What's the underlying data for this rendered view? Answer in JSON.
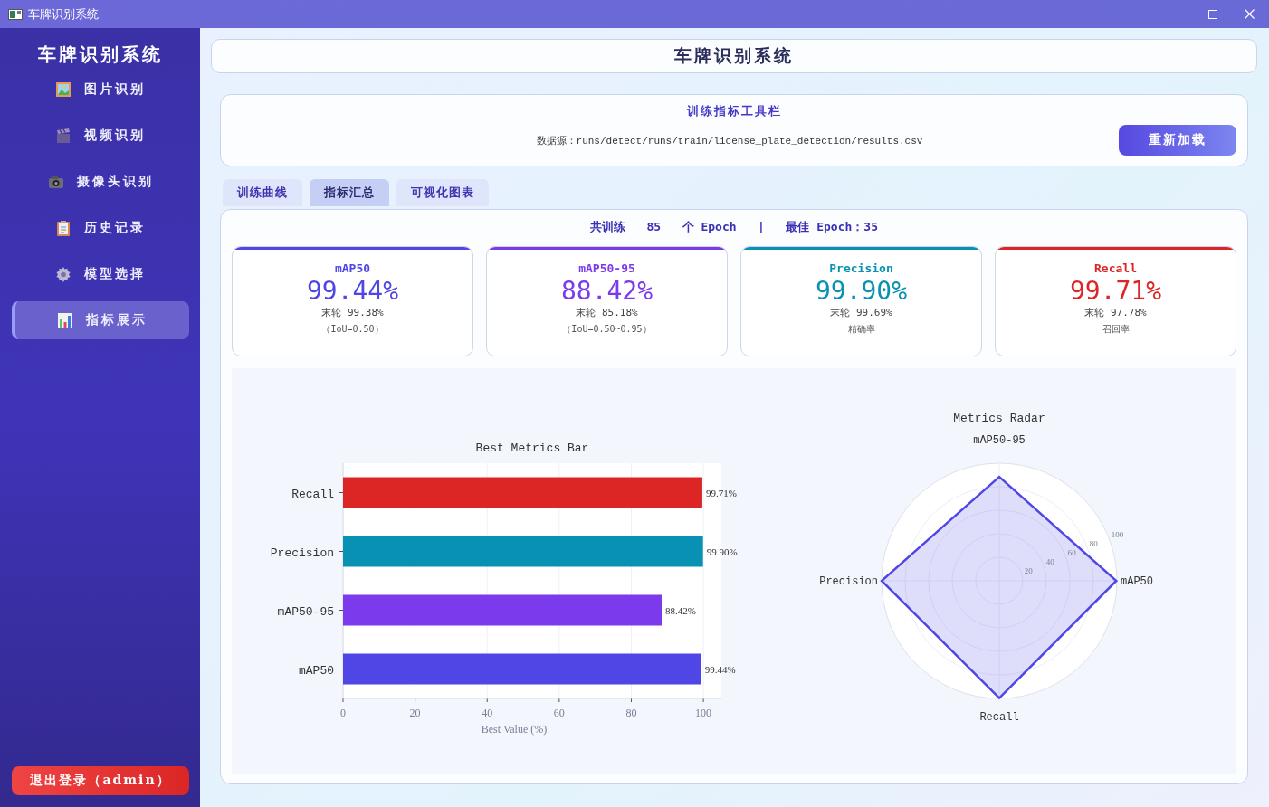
{
  "window": {
    "title": "车牌识别系统"
  },
  "sidebar": {
    "title": "车牌识别系统",
    "items": [
      {
        "label": "图片识别",
        "selected": false
      },
      {
        "label": "视频识别",
        "selected": false
      },
      {
        "label": "摄像头识别",
        "selected": false
      },
      {
        "label": "历史记录",
        "selected": false
      },
      {
        "label": "模型选择",
        "selected": false
      },
      {
        "label": "指标展示",
        "selected": true
      }
    ],
    "logout_button": "退出登录（admin）"
  },
  "header": {
    "title": "车牌识别系统"
  },
  "toolbar": {
    "title": "训练指标工具栏",
    "source": "数据源：runs/detect/runs/train/license_plate_detection/results.csv",
    "reload_button": "重新加载"
  },
  "tabs": [
    {
      "label": "训练曲线",
      "selected": false
    },
    {
      "label": "指标汇总",
      "selected": true
    },
    {
      "label": "可视化图表",
      "selected": false
    }
  ],
  "summary": "共训练   85   个 Epoch   |   最佳 Epoch：35",
  "metric_cards": [
    {
      "name": "mAP50",
      "value": "99.44%",
      "last": "末轮 99.38%",
      "note": "（IoU=0.50）",
      "color": "#4f46e5"
    },
    {
      "name": "mAP50-95",
      "value": "88.42%",
      "last": "末轮 85.18%",
      "note": "（IoU=0.50~0.95）",
      "color": "#7c3aed"
    },
    {
      "name": "Precision",
      "value": "99.90%",
      "last": "末轮 99.69%",
      "note": "精确率",
      "color": "#0891b2"
    },
    {
      "name": "Recall",
      "value": "99.71%",
      "last": "末轮 97.78%",
      "note": "召回率",
      "color": "#dc2626"
    }
  ],
  "bar_chart": {
    "chart_data": {
      "type": "bar",
      "orientation": "horizontal",
      "title": "Best Metrics Bar",
      "xlabel": "Best Value (%)",
      "categories": [
        "Recall",
        "Precision",
        "mAP50-95",
        "mAP50"
      ],
      "grid": true,
      "xlim": [
        0,
        105
      ],
      "xticks": [
        0,
        20,
        40,
        60,
        80,
        100
      ],
      "value_labels": [
        "99.71%",
        "99.90%",
        "88.42%",
        "99.44%"
      ],
      "values": [
        99.71,
        99.9,
        88.42,
        99.44
      ],
      "colors": [
        "#dc2626",
        "#0891b2",
        "#7c3aed",
        "#4f46e5"
      ]
    }
  },
  "radar_chart": {
    "chart_data": {
      "type": "radar",
      "title": "Metrics Radar",
      "categories": [
        "mAP50-95",
        "mAP50",
        "Recall",
        "Precision"
      ],
      "ylim": [
        0,
        100
      ],
      "yticks": [
        20,
        40,
        60,
        80,
        100
      ],
      "series": [
        {
          "color": "#4f46e5",
          "values": [
            88.42,
            99.44,
            99.71,
            99.9
          ]
        }
      ]
    }
  }
}
